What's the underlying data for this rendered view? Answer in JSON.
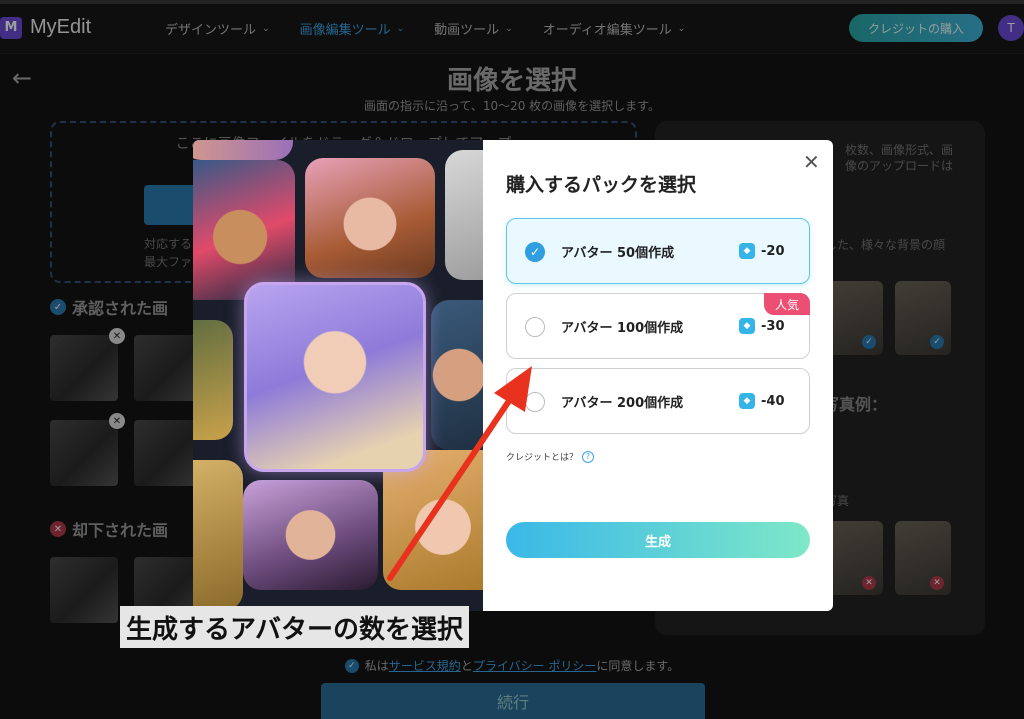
{
  "app": {
    "logo_letter": "M",
    "name": "MyEdit"
  },
  "nav": [
    {
      "label": "デザインツール",
      "active": false
    },
    {
      "label": "画像編集ツール",
      "active": true
    },
    {
      "label": "動画ツール",
      "active": false
    },
    {
      "label": "オーディオ編集ツール",
      "active": false
    }
  ],
  "header": {
    "credit_button": "クレジットの購入",
    "avatar_letter": "T"
  },
  "page": {
    "back": "←",
    "title": "画像を選択",
    "subtitle": "画面の指示に沿って、10〜20 枚の画像を選択します。"
  },
  "dropzone": {
    "text": "ここに画像ファイルをドラッグ＆ドロップしてアップ",
    "info1": "対応する",
    "info2": "最大ファ"
  },
  "sections": {
    "approved": "承認された画",
    "rejected": "却下された画"
  },
  "right_panel": {
    "text1": "枚数、画像形式、画",
    "text2": "像のアップロードは",
    "text3": "した、様々な背景の顔",
    "head": "写真例：",
    "text4": "写真"
  },
  "agree": {
    "prefix": "私は",
    "terms": "サービス規約",
    "and": "と",
    "privacy": "プライバシー ポリシー",
    "suffix": "に同意します。"
  },
  "continue_button": "続行",
  "modal": {
    "title": "購入するパックを選択",
    "close": "✕",
    "options": [
      {
        "label": "アバター 50個作成",
        "credits": "-20",
        "selected": true
      },
      {
        "label": "アバター 100個作成",
        "credits": "-30",
        "selected": false,
        "badge": "人気"
      },
      {
        "label": "アバター 200個作成",
        "credits": "-40",
        "selected": false
      }
    ],
    "credit_question": "クレジットとは？",
    "generate_button": "生成"
  },
  "annotation": {
    "caption": "生成するアバターの数を選択",
    "arrow_color": "#e8321e"
  },
  "colors": {
    "accent": "#3ea4e8",
    "popular": "#ec4f73",
    "selected_border": "#5ec7e6"
  }
}
